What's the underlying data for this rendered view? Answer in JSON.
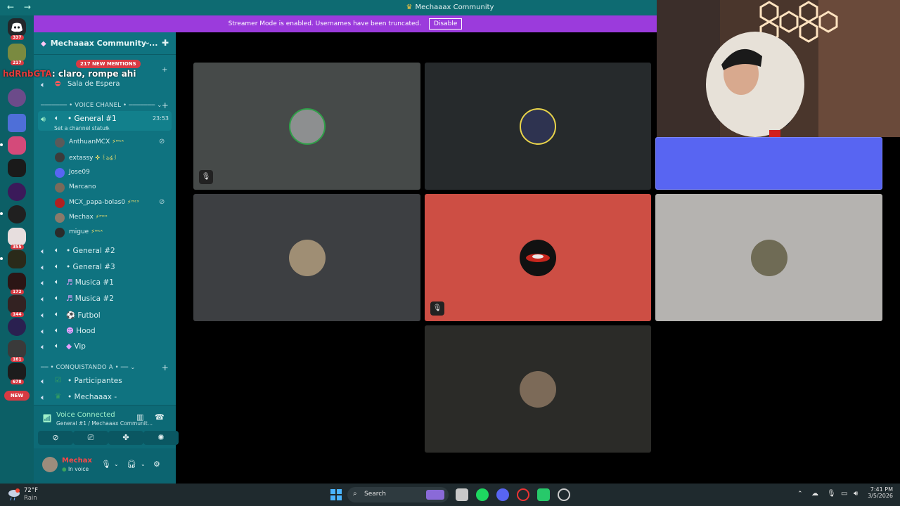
{
  "titlebar": {
    "title": "Mechaaax Community",
    "back": "←",
    "forward": "→"
  },
  "banner": {
    "text": "Streamer Mode is enabled. Usernames have been truncated.",
    "button": "Disable"
  },
  "rail": {
    "badges": [
      "337",
      "217",
      "355",
      "172",
      "144",
      "161",
      "678"
    ],
    "new_label": "NEW"
  },
  "server": {
    "name": "Mechaaax Community ..."
  },
  "mentions": "217 NEW MENTIONS",
  "chat_overlay": {
    "name": "hdRnbGTA",
    "text": ": claro, rompe ahi"
  },
  "channels": {
    "waiting_room": "Sala de Espera",
    "voice_category": "VOICE CHANEL",
    "active": {
      "name": "General #1",
      "time": "23:53",
      "status": "Set a channel status"
    },
    "users": [
      {
        "name": "AnthuanMCX",
        "tag": "⚡ᵐᶜˣ",
        "muted": true,
        "color": "#5a5a5a"
      },
      {
        "name": "extassy",
        "tag": "✜ ꒰ঌ໒꒱",
        "muted": false,
        "color": "#3b3b3b"
      },
      {
        "name": "Jose09",
        "tag": "",
        "muted": false,
        "color": "#5865f2"
      },
      {
        "name": "Marcano",
        "tag": "",
        "muted": false,
        "color": "#7a6a5a"
      },
      {
        "name": "MCX_papa-bolas0",
        "tag": "⚡ᵐᶜˣ",
        "muted": true,
        "color": "#b02020"
      },
      {
        "name": "Mechax",
        "tag": "⚡ᵐᶜˣ",
        "muted": false,
        "color": "#8a7a6a"
      },
      {
        "name": "migue",
        "tag": "⚡ᵐᶜˣ",
        "muted": false,
        "color": "#2b2b2b"
      }
    ],
    "others": [
      {
        "name": "General #2",
        "icon": ""
      },
      {
        "name": "General #3",
        "icon": ""
      },
      {
        "name": "Musica #1",
        "icon": "♬"
      },
      {
        "name": "Musica #2",
        "icon": "♬"
      },
      {
        "name": "Futbol",
        "icon": "⚽"
      },
      {
        "name": "Hood",
        "icon": "☻"
      },
      {
        "name": "Vip",
        "icon": "◆"
      }
    ],
    "conquistando_category": "CONQUISTANDO A",
    "conquistando": [
      {
        "name": "Participantes",
        "icon": "☑"
      },
      {
        "name": "Mechaaax -",
        "icon": "♛"
      }
    ]
  },
  "voice_panel": {
    "status": "Voice Connected",
    "sub": "General #1 / Mechaaax Communit..."
  },
  "user_footer": {
    "name": "Mechax",
    "status": "In voice"
  },
  "taskbar": {
    "temp": "72°F",
    "cond": "Rain",
    "search": "Search",
    "time": "7:41 PM",
    "date": "3/5/2026"
  },
  "colors": {
    "sidebar": "#0f7380",
    "banner": "#9b3bdc",
    "tile_dark": "#262a2c",
    "tile_red": "#cd4e44",
    "tile_light": "#b5b3b0",
    "tile_blue": "#5865f2"
  }
}
